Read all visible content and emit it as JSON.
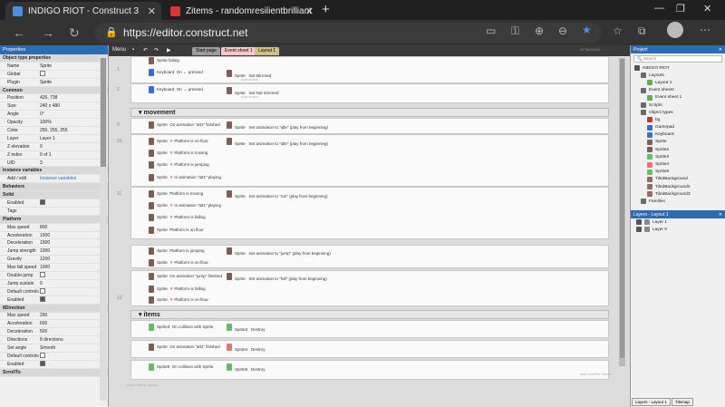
{
  "browser": {
    "tabs": [
      {
        "title": "INDIGO RIOT - Construct 3",
        "icon_color": "#4b8fe0"
      },
      {
        "title": "Zitems - randomresilientbrilliant",
        "icon_color": "#d33"
      }
    ],
    "url": "https://editor.construct.net"
  },
  "menu": {
    "label": "Menu"
  },
  "editor_tabs": [
    {
      "label": "Start page",
      "bg": "#9c9c9c"
    },
    {
      "label": "Event sheet 1",
      "bg": "#f7c8c8"
    },
    {
      "label": "Layout 1",
      "bg": "#cfc08a"
    }
  ],
  "properties": {
    "title": "Properties",
    "rows": [
      {
        "k": "Object type properties",
        "v": "",
        "sec": true
      },
      {
        "k": "Name",
        "v": "Sprite"
      },
      {
        "k": "Global",
        "v": "",
        "chk": false
      },
      {
        "k": "Plugin",
        "v": "Sprite"
      },
      {
        "k": "Common",
        "v": "",
        "sec": true
      },
      {
        "k": "Position",
        "v": "426, 738"
      },
      {
        "k": "Size",
        "v": "240 x 480"
      },
      {
        "k": "Angle",
        "v": "0°"
      },
      {
        "k": "Opacity",
        "v": "100%"
      },
      {
        "k": "Color",
        "v": "255, 255, 255"
      },
      {
        "k": "Layer",
        "v": "Layer 1"
      },
      {
        "k": "Z elevation",
        "v": "0"
      },
      {
        "k": "Z index",
        "v": "0 of 1"
      },
      {
        "k": "UID",
        "v": "3"
      },
      {
        "k": "Instance variables",
        "v": "",
        "sec": true
      },
      {
        "k": "Add / edit",
        "v": "Instance variables"
      },
      {
        "k": "Behaviors",
        "v": "",
        "sec": true
      },
      {
        "k": "Solid",
        "v": "",
        "sec": true
      },
      {
        "k": "Enabled",
        "v": "",
        "chk": true
      },
      {
        "k": "Tags",
        "v": ""
      },
      {
        "k": "Platform",
        "v": "",
        "sec": true
      },
      {
        "k": "Max speed",
        "v": "800"
      },
      {
        "k": "Acceleration",
        "v": "1500"
      },
      {
        "k": "Deceleration",
        "v": "1500"
      },
      {
        "k": "Jump strength",
        "v": "1000"
      },
      {
        "k": "Gravity",
        "v": "1200"
      },
      {
        "k": "Max fall speed",
        "v": "1000"
      },
      {
        "k": "Double-jump",
        "v": "",
        "chk": false
      },
      {
        "k": "Jump sustain",
        "v": "0"
      },
      {
        "k": "Default controls",
        "v": "",
        "chk": false
      },
      {
        "k": "Enabled",
        "v": "",
        "chk": true
      },
      {
        "k": "8Direction",
        "v": "",
        "sec": true
      },
      {
        "k": "Max speed",
        "v": "200"
      },
      {
        "k": "Acceleration",
        "v": "600"
      },
      {
        "k": "Deceleration",
        "v": "500"
      },
      {
        "k": "Directions",
        "v": "8 directions"
      },
      {
        "k": "Set angle",
        "v": "Smooth"
      },
      {
        "k": "Default controls",
        "v": "",
        "chk": false
      },
      {
        "k": "Enabled",
        "v": "",
        "chk": true
      },
      {
        "k": "ScrollTo",
        "v": "",
        "sec": true
      }
    ]
  },
  "events": {
    "e1_cond1": "failing",
    "e1_cond2_obj": "Keyboard",
    "e1_cond2_text": "On ← pressed",
    "e1_act": "Set Mirrored",
    "e2_cond_obj": "Keyboard",
    "e2_cond_text": "On → pressed",
    "e2_act": "Set Not mirrored",
    "group_movement": "movement",
    "e9_cond": "On animation \"att1\" finished",
    "e9_act": "Set animation to \"idle\" (play from beginning)",
    "e10_c1": "Platform is on floor",
    "e10_c2": "Platform is moving",
    "e10_c3": "Platform is jumping",
    "e10_c4": "Is animation \"att1\" playing",
    "e10_act": "Set animation to \"idle\" (play from beginning)",
    "e11_c1": "Platform is moving",
    "e11_c2": "Is animation \"att1\" playing",
    "e11_c3": "Platform is falling",
    "e11_c4": "Platform is on floor",
    "e11_act": "Set animation to \"run\" (play from beginning)",
    "e12_c1": "Platform is jumping",
    "e12_c2": "Platform is on floor",
    "e12_act": "Set animation to \"jump\" (play from beginning)",
    "e13_c1": "On animation \"jump\" finished",
    "e13_c2": "Platform is falling",
    "e13_c3": "Platform is on floor",
    "e13_act": "Set animation to \"fall\" (play from beginning)",
    "group_items": "items",
    "e15_cond": "On collision with Sprite",
    "e15_act_obj": "Sprite3",
    "e15_act": "Destroy",
    "e16_cond": "On animation \"att1\" finished",
    "e16_act_obj": "Sprite4",
    "e16_act": "Destroy",
    "e17_cond": "On collision with Sprite",
    "e17_act_obj": "Sprite5",
    "e17_act": "Destroy",
    "obj_sprite": "Sprite",
    "add_action": "Add action",
    "add_event": "Add event to group",
    "add_event_root": "Add event to 'items'"
  },
  "project": {
    "title": "Project",
    "search": "Search",
    "tree": [
      {
        "label": "INDIGO RIOT",
        "indent": 0,
        "color": "#555"
      },
      {
        "label": "Layouts",
        "indent": 1,
        "color": "#6a6a6a"
      },
      {
        "label": "Layout 1",
        "indent": 2,
        "color": "#6aa84f"
      },
      {
        "label": "Event sheets",
        "indent": 1,
        "color": "#6a6a6a"
      },
      {
        "label": "Event sheet 1",
        "indent": 2,
        "color": "#6aa84f"
      },
      {
        "label": "Scripts",
        "indent": 1,
        "color": "#6a6a6a"
      },
      {
        "label": "Object types",
        "indent": 1,
        "color": "#6a6a6a"
      },
      {
        "label": "bg",
        "indent": 2,
        "color": "#d32f2f"
      },
      {
        "label": "Gamepad",
        "indent": 2,
        "color": "#3b6bd6"
      },
      {
        "label": "Keyboard",
        "indent": 2,
        "color": "#3b6bd6"
      },
      {
        "label": "Sprite",
        "indent": 2,
        "color": "#7b5e57"
      },
      {
        "label": "Sprite2",
        "indent": 2,
        "color": "#7b5e57"
      },
      {
        "label": "Sprite3",
        "indent": 2,
        "color": "#66bb6a"
      },
      {
        "label": "Sprite4",
        "indent": 2,
        "color": "#e57373"
      },
      {
        "label": "Sprite5",
        "indent": 2,
        "color": "#66bb6a"
      },
      {
        "label": "TiledBackground",
        "indent": 2,
        "color": "#8d6e63"
      },
      {
        "label": "TiledBackground2",
        "indent": 2,
        "color": "#8d6e63"
      },
      {
        "label": "TiledBackground3",
        "indent": 2,
        "color": "#8d6e63"
      },
      {
        "label": "Families",
        "indent": 1,
        "color": "#6a6a6a"
      }
    ]
  },
  "layers": {
    "title": "Layers - Layout 1",
    "items": [
      "Layer 1",
      "Layer 0"
    ],
    "tab1": "Layers - Layout 1",
    "tab2": "Tilemap"
  },
  "status": {
    "right_hint": "ATTACK/ALL"
  }
}
